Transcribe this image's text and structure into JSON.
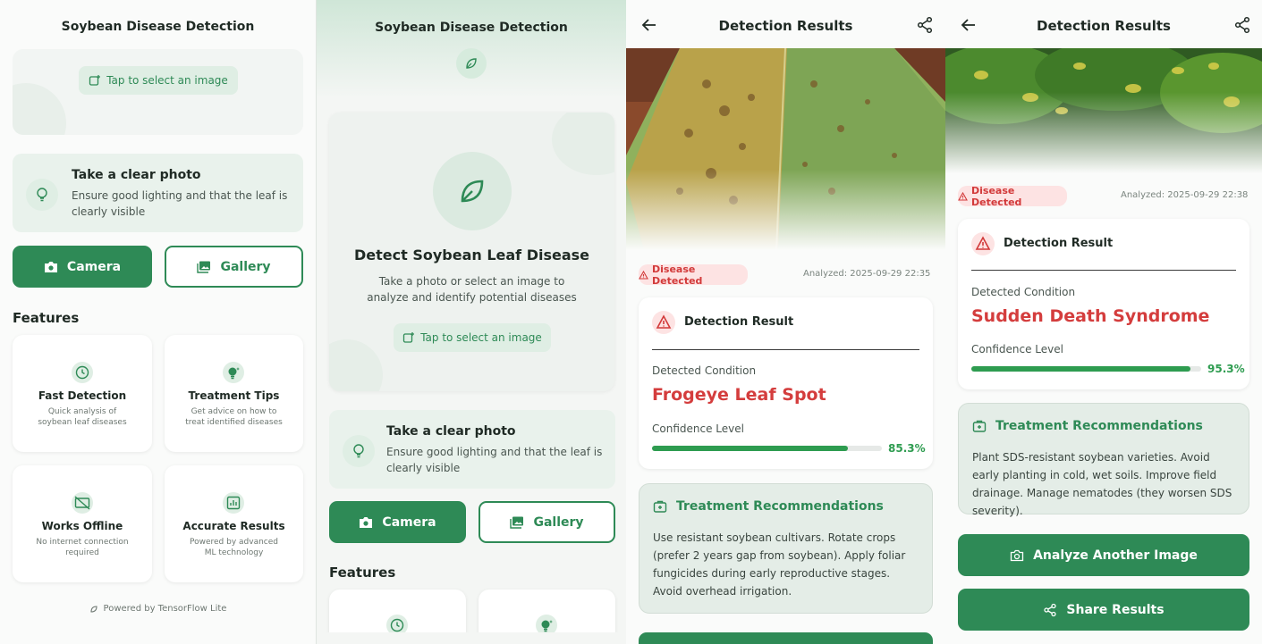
{
  "app_title": "Soybean Disease Detection",
  "home": {
    "select_image_label": "Tap to select an image",
    "tip": {
      "title": "Take a clear photo",
      "text": "Ensure good lighting and that the leaf is clearly visible"
    },
    "camera_label": "Camera",
    "gallery_label": "Gallery",
    "features_title": "Features",
    "features": [
      {
        "title": "Fast Detection",
        "subtitle": "Quick analysis of soybean leaf diseases",
        "icon": "clock-icon"
      },
      {
        "title": "Treatment Tips",
        "subtitle": "Get advice on how to treat identified diseases",
        "icon": "lightbulb-icon"
      },
      {
        "title": "Works Offline",
        "subtitle": "No internet connection required",
        "icon": "offline-icon"
      },
      {
        "title": "Accurate Results",
        "subtitle": "Powered by advanced ML technology",
        "icon": "chart-icon"
      }
    ],
    "footer": "Powered by TensorFlow Lite"
  },
  "home_top": {
    "headline": "Detect Soybean Leaf Disease",
    "description": "Take a photo or select an image to analyze and identify potential diseases"
  },
  "results_title": "Detection Results",
  "result1": {
    "badge": "Disease Detected",
    "analyzed": "Analyzed: 2025-09-29 22:35",
    "card_title": "Detection Result",
    "condition_label": "Detected Condition",
    "condition": "Frogeye Leaf Spot",
    "confidence_label": "Confidence Level",
    "confidence": 0.853,
    "confidence_text": "85.3%",
    "treatment_title": "Treatment Recommendations",
    "treatment_text": "Use resistant soybean cultivars. Rotate crops (prefer 2 years gap from soybean). Apply foliar fungicides during early reproductive stages. Avoid overhead irrigation."
  },
  "result2": {
    "badge": "Disease Detected",
    "analyzed": "Analyzed: 2025-09-29 22:38",
    "card_title": "Detection Result",
    "condition_label": "Detected Condition",
    "condition": "Sudden Death Syndrome",
    "confidence_label": "Confidence Level",
    "confidence": 0.953,
    "confidence_text": "95.3%",
    "treatment_title": "Treatment Recommendations",
    "treatment_text": "Plant SDS-resistant soybean varieties. Avoid early planting in cold, wet soils. Improve field drainage. Manage nematodes (they worsen SDS severity).",
    "analyze_label": "Analyze Another Image",
    "share_label": "Share Results"
  },
  "colors": {
    "primary": "#2e8a56",
    "danger": "#d43d3d",
    "progress": "#2e9c50",
    "soft": "#e9f2ec"
  }
}
